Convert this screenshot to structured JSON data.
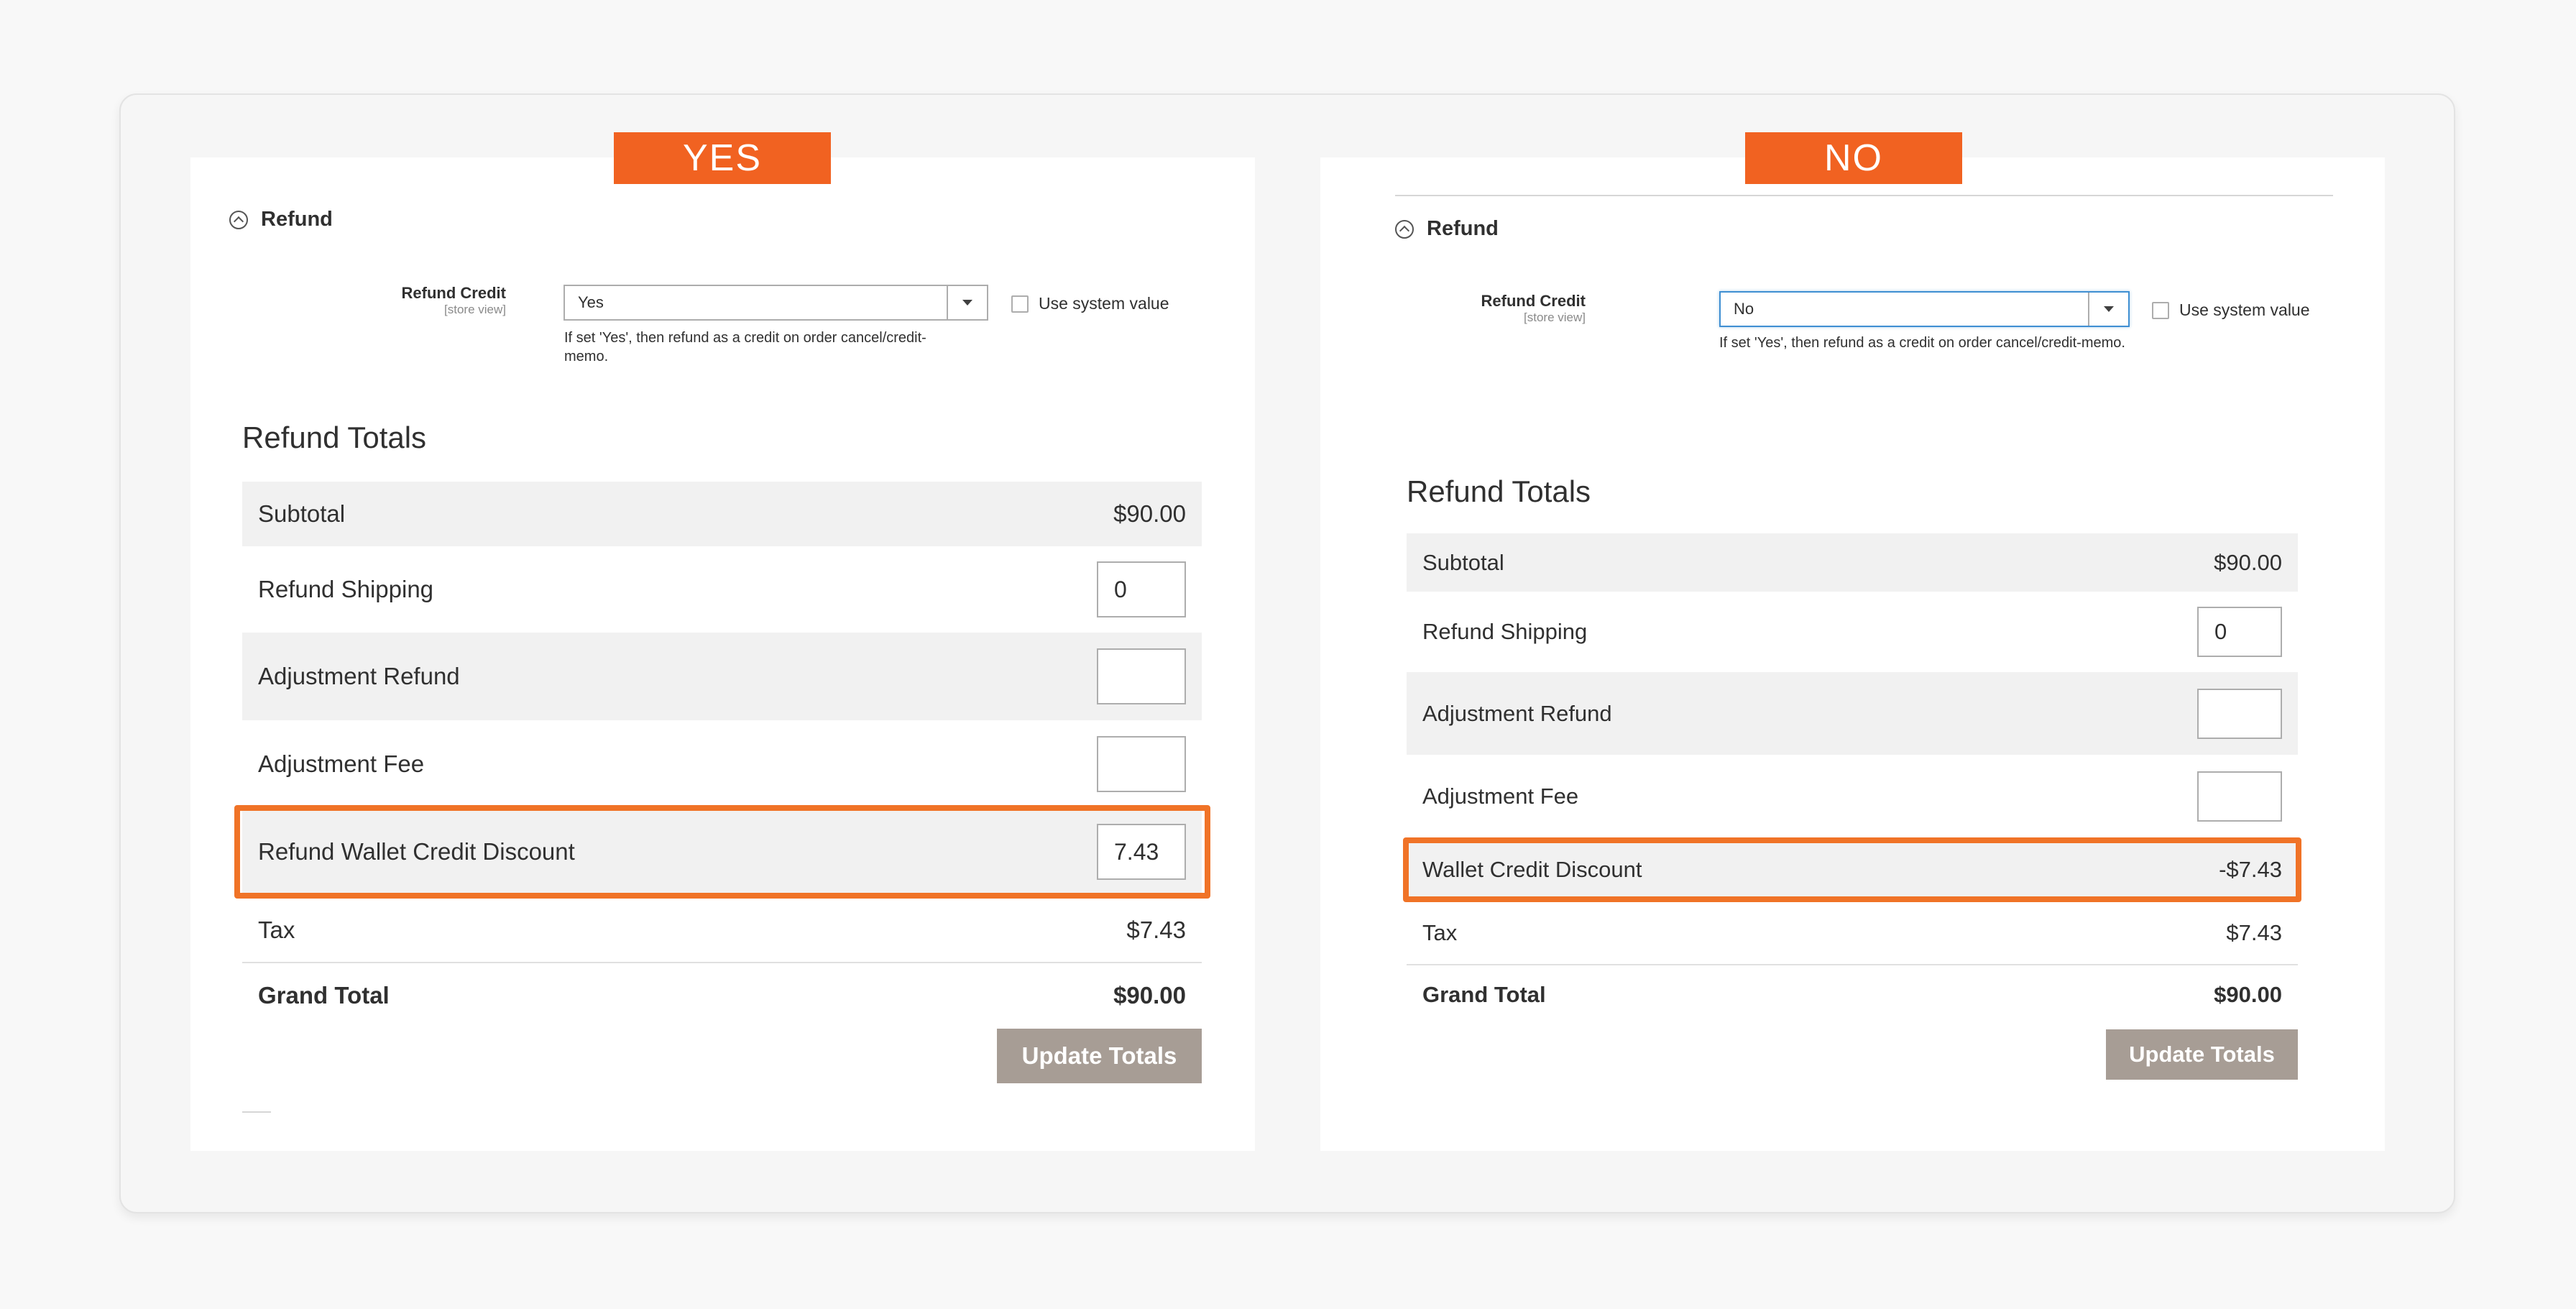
{
  "colors": {
    "accent": "#f16221",
    "highlight": "#f07327",
    "button": "#a79d95"
  },
  "panels": {
    "yes": {
      "tag": "YES",
      "section_title": "Refund",
      "field_label": "Refund Credit",
      "field_scope": "[store view]",
      "select_value": "Yes",
      "system_value_label": "Use system value",
      "hint_line1": "If set 'Yes', then refund as a credit on order cancel/credit-",
      "hint_line2": "memo.",
      "totals_title": "Refund Totals",
      "rows": {
        "subtotal": {
          "label": "Subtotal",
          "value": "$90.00"
        },
        "shipping": {
          "label": "Refund Shipping",
          "value": "0"
        },
        "adj_refund": {
          "label": "Adjustment Refund",
          "value": ""
        },
        "adj_fee": {
          "label": "Adjustment Fee",
          "value": ""
        },
        "wallet": {
          "label": "Refund Wallet Credit Discount",
          "value": "7.43"
        },
        "tax": {
          "label": "Tax",
          "value": "$7.43"
        },
        "grand": {
          "label": "Grand Total",
          "value": "$90.00"
        }
      },
      "button": "Update Totals"
    },
    "no": {
      "tag": "NO",
      "section_title": "Refund",
      "field_label": "Refund Credit",
      "field_scope": "[store view]",
      "select_value": "No",
      "system_value_label": "Use system value",
      "hint_line1": "If set 'Yes', then refund as a credit on order cancel/credit-memo.",
      "totals_title": "Refund Totals",
      "rows": {
        "subtotal": {
          "label": "Subtotal",
          "value": "$90.00"
        },
        "shipping": {
          "label": "Refund Shipping",
          "value": "0"
        },
        "adj_refund": {
          "label": "Adjustment Refund",
          "value": ""
        },
        "adj_fee": {
          "label": "Adjustment Fee",
          "value": ""
        },
        "wallet": {
          "label": "Wallet Credit Discount",
          "value": "-$7.43"
        },
        "tax": {
          "label": "Tax",
          "value": "$7.43"
        },
        "grand": {
          "label": "Grand Total",
          "value": "$90.00"
        }
      },
      "button": "Update Totals"
    }
  }
}
